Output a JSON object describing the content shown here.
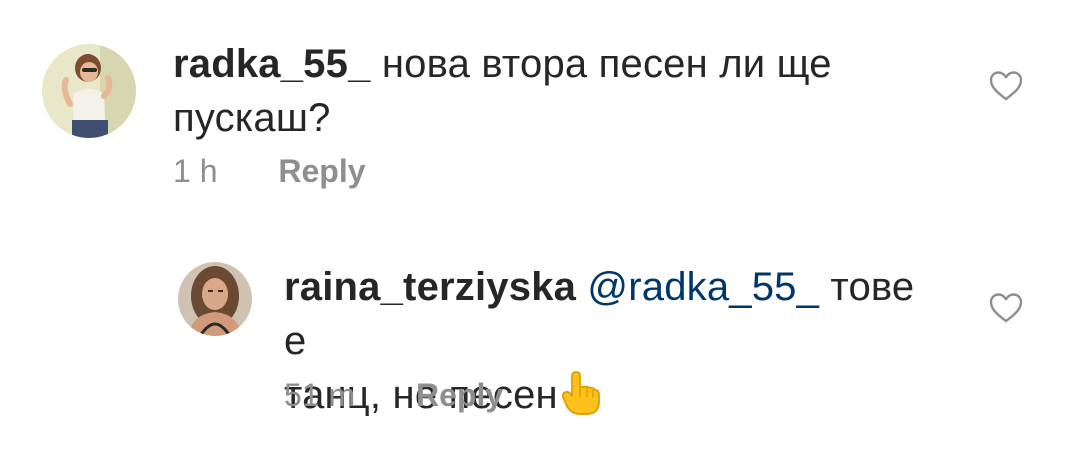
{
  "comments": [
    {
      "username": "radka_55_",
      "text": "нова втора песен ли ще пускаш?",
      "time": "1 h",
      "reply_label": "Reply",
      "liked": false
    },
    {
      "username": "raina_terziyska",
      "mention": "@radka_55_",
      "text_line1": "тове е",
      "text_line2": "танц, не песен",
      "emoji": "backhand-index-pointing-up",
      "time": "51 m",
      "reply_label": "Reply",
      "liked": false
    }
  ],
  "colors": {
    "text": "#262626",
    "secondary": "#8e8e8e",
    "mention": "#00376b",
    "heart_outline": "#8e8e8e"
  }
}
